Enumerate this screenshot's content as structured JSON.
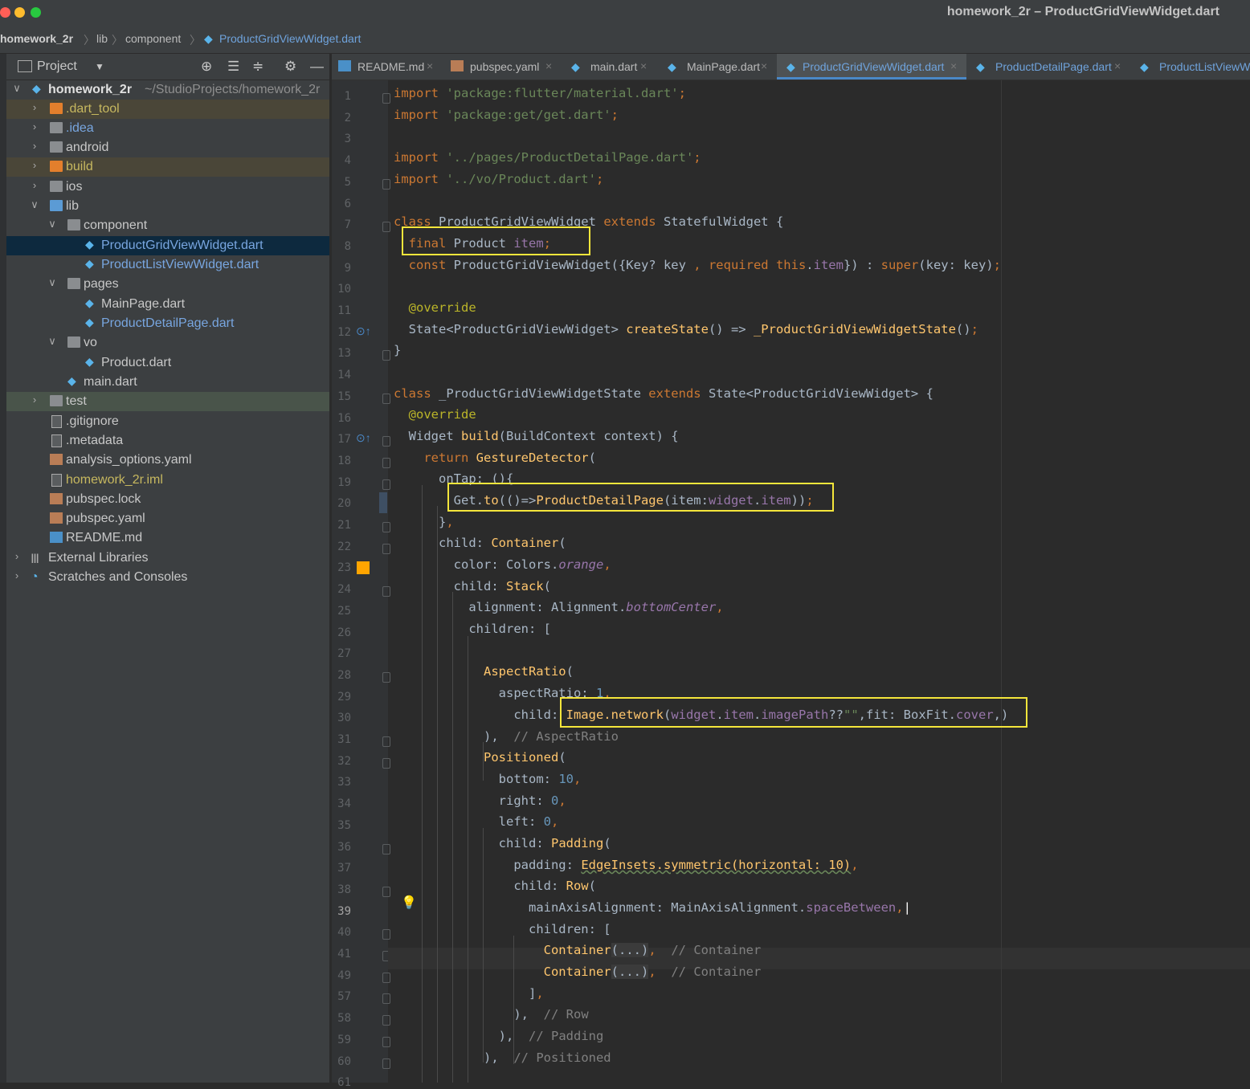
{
  "window": {
    "title": "homework_2r – ProductGridViewWidget.dart"
  },
  "breadcrumb": [
    "homework_2r",
    "lib",
    "component",
    "ProductGridViewWidget.dart"
  ],
  "project_panel": {
    "title": "Project"
  },
  "tree": [
    {
      "label": "homework_2r",
      "path": "~/StudioProjects/homework_2r"
    },
    {
      "label": ".dart_tool"
    },
    {
      "label": ".idea"
    },
    {
      "label": "android"
    },
    {
      "label": "build"
    },
    {
      "label": "ios"
    },
    {
      "label": "lib"
    },
    {
      "label": "component"
    },
    {
      "label": "ProductGridViewWidget.dart"
    },
    {
      "label": "ProductListViewWidget.dart"
    },
    {
      "label": "pages"
    },
    {
      "label": "MainPage.dart"
    },
    {
      "label": "ProductDetailPage.dart"
    },
    {
      "label": "vo"
    },
    {
      "label": "Product.dart"
    },
    {
      "label": "main.dart"
    },
    {
      "label": "test"
    },
    {
      "label": ".gitignore"
    },
    {
      "label": ".metadata"
    },
    {
      "label": "analysis_options.yaml"
    },
    {
      "label": "homework_2r.iml"
    },
    {
      "label": "pubspec.lock"
    },
    {
      "label": "pubspec.yaml"
    },
    {
      "label": "README.md"
    },
    {
      "label": "External Libraries"
    },
    {
      "label": "Scratches and Consoles"
    }
  ],
  "tabs": [
    "README.md",
    "pubspec.yaml",
    "main.dart",
    "MainPage.dart",
    "ProductGridViewWidget.dart",
    "ProductDetailPage.dart",
    "ProductListViewWi"
  ],
  "line_numbers": [
    "1",
    "2",
    "3",
    "4",
    "5",
    "6",
    "7",
    "8",
    "9",
    "10",
    "11",
    "12",
    "13",
    "14",
    "15",
    "16",
    "17",
    "18",
    "19",
    "20",
    "21",
    "22",
    "23",
    "24",
    "25",
    "26",
    "27",
    "28",
    "29",
    "30",
    "31",
    "32",
    "33",
    "34",
    "35",
    "36",
    "37",
    "38",
    "39",
    "40",
    "41",
    "49",
    "57",
    "58",
    "59",
    "60",
    "61"
  ],
  "code": {
    "l1a": "import ",
    "l1b": "'package:flutter/material.dart'",
    "l1c": ";",
    "l2a": "import ",
    "l2b": "'package:get/get.dart'",
    "l2c": ";",
    "l4a": "import ",
    "l4b": "'../pages/ProductDetailPage.dart'",
    "l4c": ";",
    "l5a": "import ",
    "l5b": "'../vo/Product.dart'",
    "l5c": ";",
    "l7a": "class ",
    "l7b": "ProductGridViewWidget ",
    "l7c": "extends ",
    "l7d": "StatefulWidget {",
    "l8a": "final ",
    "l8b": "Product ",
    "l8c": "item",
    "l8d": ";",
    "l9a": "const ",
    "l9b": "ProductGridViewWidget({Key? key ",
    "l9c": ", required ",
    "l9d": "this",
    "l9e": ".",
    "l9f": "item",
    "l9g": "}) : ",
    "l9h": "super",
    "l9i": "(key: key)",
    "l9j": ";",
    "l11": "@override",
    "l12a": "State<ProductGridViewWidget> ",
    "l12b": "createState",
    "l12c": "() => ",
    "l12d": "_ProductGridViewWidgetState",
    "l12e": "()",
    "l12f": ";",
    "l13": "}",
    "l15a": "class ",
    "l15b": "_ProductGridViewWidgetState ",
    "l15c": "extends ",
    "l15d": "State<ProductGridViewWidget> {",
    "l16": "@override",
    "l17a": "Widget ",
    "l17b": "build",
    "l17c": "(BuildContext context) {",
    "l18a": "return ",
    "l18b": "GestureDetector",
    "l18c": "(",
    "l19": "onTap: (){",
    "l20a": "Get.",
    "l20b": "to",
    "l20c": "(()=>",
    "l20d": "ProductDetailPage",
    "l20e": "(item:",
    "l20f": "widget",
    "l20g": ".",
    "l20h": "item",
    "l20i": "))",
    "l20j": ";",
    "l21a": "}",
    "l21b": ",",
    "l22a": "child: ",
    "l22b": "Container",
    "l22c": "(",
    "l23a": "color: Colors.",
    "l23b": "orange",
    "l23c": ",",
    "l24a": "child: ",
    "l24b": "Stack",
    "l24c": "(",
    "l25a": "alignment: Alignment.",
    "l25b": "bottomCenter",
    "l25c": ",",
    "l26": "children: [",
    "l28a": "AspectRatio",
    "l28b": "(",
    "l29a": "aspectRatio: ",
    "l29b": "1",
    "l29c": ",",
    "l30a": "child: ",
    "l30b": "Image.",
    "l30c": "network",
    "l30d": "(",
    "l30e": "widget",
    "l30f": ".",
    "l30g": "item",
    "l30h": ".",
    "l30i": "imagePath",
    "l30j": "??",
    "l30k": "\"\"",
    "l30l": ",fit: BoxFit.",
    "l30m": "cover",
    "l30n": ",)",
    "l31a": "),",
    "l31b": "// AspectRatio",
    "l32a": "Positioned",
    "l32b": "(",
    "l33a": "bottom: ",
    "l33b": "10",
    "l33c": ",",
    "l34a": "right: ",
    "l34b": "0",
    "l34c": ",",
    "l35a": "left: ",
    "l35b": "0",
    "l35c": ",",
    "l36a": "child: ",
    "l36b": "Padding",
    "l36c": "(",
    "l37a": "padding: ",
    "l37b": "EdgeInsets.symmetric(horizontal: 10)",
    "l37c": ",",
    "l38a": "child: ",
    "l38b": "Row",
    "l38c": "(",
    "l39a": "mainAxisAlignment: MainAxisAlignment.",
    "l39b": "spaceBetween",
    "l39c": ",",
    "l40": "children: [",
    "l41a": "Container",
    "l41b": "(...)",
    "l41c": ",",
    "l41d": "// Container",
    "l49a": "Container",
    "l49b": "(...)",
    "l49c": ",",
    "l49d": "// Container",
    "l57a": "]",
    "l57b": ",",
    "l58a": "),",
    "l58b": "// Row",
    "l59a": "),",
    "l59b": "// Padding",
    "l60a": "),",
    "l60b": "// Positioned"
  },
  "colors": {
    "keyword": "#cc7832",
    "string": "#6a8759",
    "function": "#ffc66d",
    "member": "#9876aa",
    "number": "#6897bb",
    "highlight": "#f5e63b"
  }
}
